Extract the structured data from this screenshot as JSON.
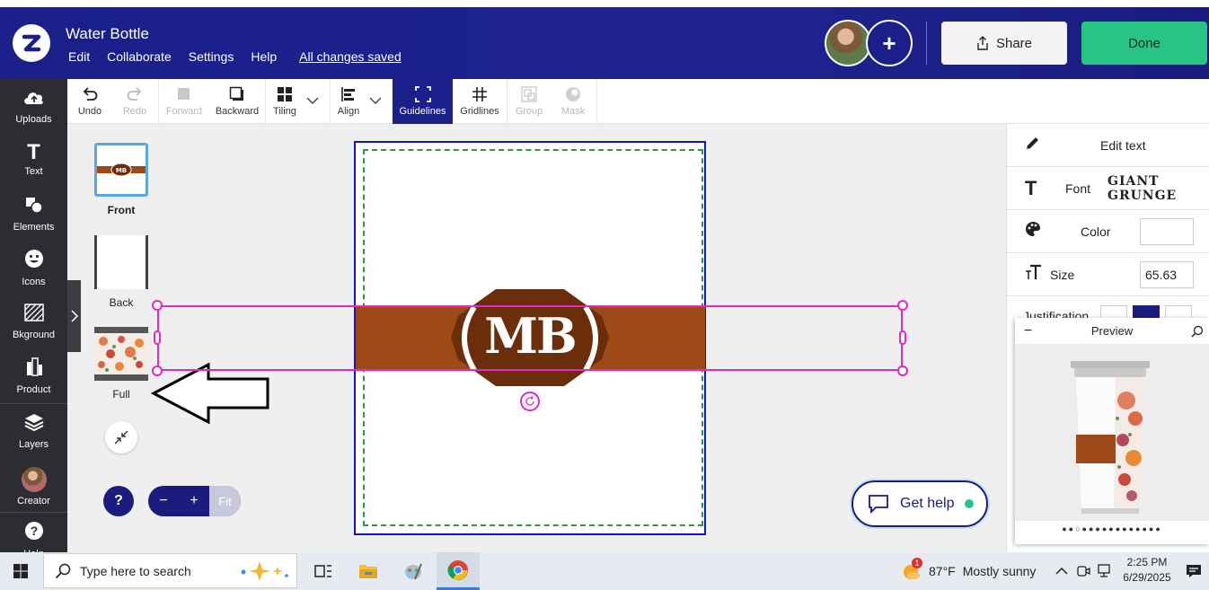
{
  "header": {
    "title": "Water Bottle",
    "menu": [
      "Edit",
      "Collaborate",
      "Settings",
      "Help"
    ],
    "saved_status": "All changes saved",
    "share_label": "Share",
    "done_label": "Done"
  },
  "sidebar": {
    "items": [
      {
        "label": "Uploads",
        "icon": "cloud-upload-icon"
      },
      {
        "label": "Text",
        "icon": "text-icon"
      },
      {
        "label": "Elements",
        "icon": "elements-icon"
      },
      {
        "label": "Icons",
        "icon": "smiley-icon"
      },
      {
        "label": "Bkground",
        "icon": "background-icon"
      },
      {
        "label": "Product",
        "icon": "product-icon"
      },
      {
        "label": "Layers",
        "icon": "layers-icon"
      },
      {
        "label": "Creator",
        "icon": "avatar"
      },
      {
        "label": "Help",
        "icon": "help-icon"
      }
    ]
  },
  "toolbar": {
    "undo": "Undo",
    "redo": "Redo",
    "forward": "Forward",
    "backward": "Backward",
    "tiling": "Tiling",
    "align": "Align",
    "guidelines": "Guidelines",
    "gridlines": "Gridlines",
    "group": "Group",
    "mask": "Mask"
  },
  "views": {
    "front": "Front",
    "back": "Back",
    "full": "Full"
  },
  "design": {
    "monogram": "MB",
    "band_color": "#9e4a16",
    "badge_color": "#6b2d0a"
  },
  "zoom": {
    "minus": "−",
    "plus": "+",
    "fit": "Fit"
  },
  "help_button": "?",
  "get_help": "Get help",
  "panel": {
    "edit_text": "Edit text",
    "font_label": "Font",
    "font_value": "GIANT GRUNGE",
    "color_label": "Color",
    "size_label": "Size",
    "size_value": "65.63",
    "justification_label": "Justification"
  },
  "preview": {
    "title": "Preview",
    "minimize": "−"
  },
  "taskbar": {
    "search_placeholder": "Type here to search",
    "temperature": "87°F",
    "weather": "Mostly sunny",
    "time": "2:25 PM",
    "date": "6/29/2025",
    "weather_badge": "1"
  }
}
